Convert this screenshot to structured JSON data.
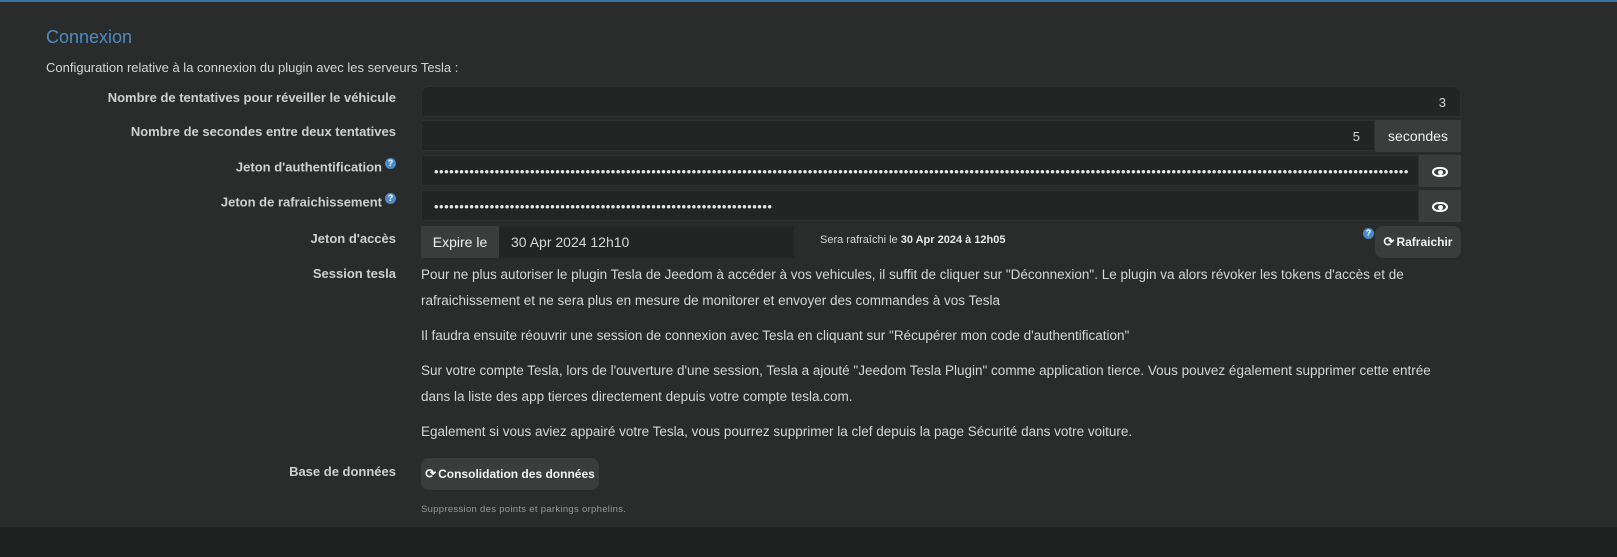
{
  "section": {
    "title": "Connexion",
    "description": "Configuration relative à la connexion du plugin avec les serveurs Tesla :"
  },
  "wake_attempts": {
    "label": "Nombre de tentatives pour réveiller le véhicule",
    "value": "3"
  },
  "seconds_between": {
    "label": "Nombre de secondes entre deux tentatives",
    "value": "5",
    "unit": "secondes"
  },
  "auth_token": {
    "label": "Jeton d'authentification",
    "masked_value": "••••••••••••••••••••••••••••••••••••••••••••••••••••••••••••••••••••••••••••••••••••••••••••••••••••••••••••••••••••••••••••••••••••••••••••••••••••••••••••••••••••••••••••••••••••••••••••••••••••••••••••••"
  },
  "refresh_token": {
    "label": "Jeton de rafraichissement",
    "masked_value": "•••••••••••••••••••••••••••••••••••••••••••••••••••••••••••••••••••"
  },
  "access_token": {
    "label": "Jeton d'accès",
    "expire_label": "Expire le",
    "expire_value": "30 Apr 2024 12h10",
    "refresh_info_prefix": "Sera rafraîchi le",
    "refresh_info_date": "30 Apr 2024 à 12h05",
    "refresh_button": "Rafraichir"
  },
  "session": {
    "label": "Session tesla",
    "paragraphs": [
      "Pour ne plus autoriser le plugin Tesla de Jeedom à accéder à vos vehicules, il suffit de cliquer sur \"Déconnexion\". Le plugin va alors révoker les tokens d'accès et de rafraichissement et ne sera plus en mesure de monitorer et envoyer des commandes à vos Tesla",
      "Il faudra ensuite réouvrir une session de connexion avec Tesla en cliquant sur \"Récupérer mon code d'authentification\"",
      "Sur votre compte Tesla, lors de l'ouverture d'une session, Tesla a ajouté \"Jeedom Tesla Plugin\" comme application tierce. Vous pouvez également supprimer cette entrée dans la liste des app tierces directement depuis votre compte tesla.com.",
      "Egalement si vous aviez appairé votre Tesla, vous pourrez supprimer la clef depuis la page Sécurité dans votre voiture."
    ]
  },
  "database": {
    "label": "Base de données",
    "button": "Consolidation des données",
    "note": "Suppression des points et parkings orphelins."
  },
  "icons": {
    "help": "question-circle-icon",
    "eye": "eye-icon",
    "sync": "sync-icon"
  },
  "colors": {
    "accent": "#4d8bc6",
    "panel_bg": "#2a2b2b",
    "page_bg": "#1f2020"
  }
}
